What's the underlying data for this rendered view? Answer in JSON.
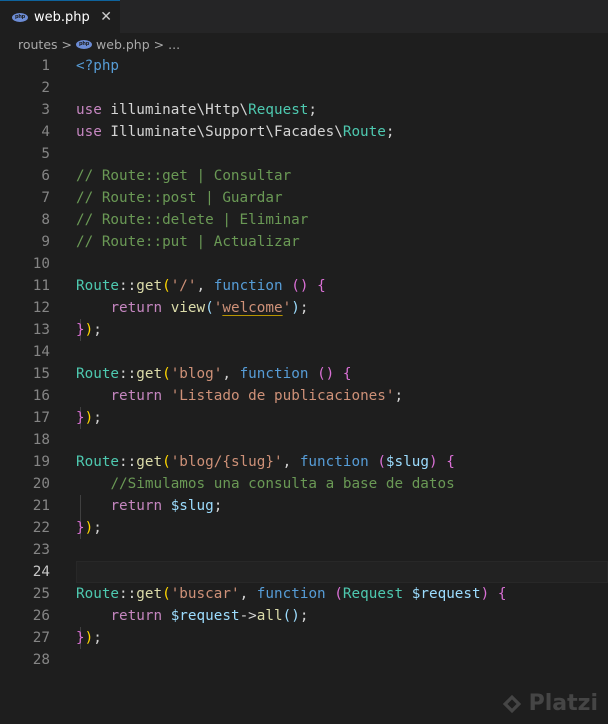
{
  "tab": {
    "title": "web.php",
    "close": "✕",
    "icon": "php-icon"
  },
  "breadcrumb": {
    "folder": "routes",
    "sep1": ">",
    "file": "web.php",
    "sep2": ">",
    "more": "..."
  },
  "editor": {
    "current_line": 24,
    "lines": [
      {
        "n": "1",
        "tokens": [
          {
            "c": "kw",
            "t": "<?php"
          }
        ]
      },
      {
        "n": "2",
        "tokens": []
      },
      {
        "n": "3",
        "tokens": [
          {
            "c": "ctl",
            "t": "use"
          },
          {
            "c": "pl",
            "t": " illuminate\\Http\\"
          },
          {
            "c": "cls",
            "t": "Request"
          },
          {
            "c": "pl",
            "t": ";"
          }
        ]
      },
      {
        "n": "4",
        "tokens": [
          {
            "c": "ctl",
            "t": "use"
          },
          {
            "c": "pl",
            "t": " Illuminate\\Support\\Facades\\"
          },
          {
            "c": "cls",
            "t": "Route"
          },
          {
            "c": "pl",
            "t": ";"
          }
        ]
      },
      {
        "n": "5",
        "tokens": []
      },
      {
        "n": "6",
        "tokens": [
          {
            "c": "cmt",
            "t": "// Route::get | Consultar"
          }
        ]
      },
      {
        "n": "7",
        "tokens": [
          {
            "c": "cmt",
            "t": "// Route::post | Guardar"
          }
        ]
      },
      {
        "n": "8",
        "tokens": [
          {
            "c": "cmt",
            "t": "// Route::delete | Eliminar"
          }
        ]
      },
      {
        "n": "9",
        "tokens": [
          {
            "c": "cmt",
            "t": "// Route::put | Actualizar"
          }
        ]
      },
      {
        "n": "10",
        "tokens": []
      },
      {
        "n": "11",
        "tokens": [
          {
            "c": "cls",
            "t": "Route"
          },
          {
            "c": "pl",
            "t": "::"
          },
          {
            "c": "fn",
            "t": "get"
          },
          {
            "c": "br1",
            "t": "("
          },
          {
            "c": "str",
            "t": "'/'"
          },
          {
            "c": "pl",
            "t": ", "
          },
          {
            "c": "kw",
            "t": "function"
          },
          {
            "c": "pl",
            "t": " "
          },
          {
            "c": "br2",
            "t": "()"
          },
          {
            "c": "pl",
            "t": " "
          },
          {
            "c": "br2",
            "t": "{"
          }
        ]
      },
      {
        "n": "12",
        "tokens": [
          {
            "c": "pl",
            "t": "    "
          },
          {
            "c": "ctl",
            "t": "return"
          },
          {
            "c": "pl",
            "t": " "
          },
          {
            "c": "fn",
            "t": "view"
          },
          {
            "c": "var",
            "t": "("
          },
          {
            "c": "str",
            "t": "'"
          },
          {
            "c": "str squiggle",
            "t": "welcome"
          },
          {
            "c": "str",
            "t": "'"
          },
          {
            "c": "var",
            "t": ")"
          },
          {
            "c": "pl",
            "t": ";"
          }
        ]
      },
      {
        "n": "13",
        "tokens": [
          {
            "c": "br2",
            "t": "}"
          },
          {
            "c": "br1",
            "t": ")"
          },
          {
            "c": "pl",
            "t": ";"
          }
        ]
      },
      {
        "n": "14",
        "tokens": []
      },
      {
        "n": "15",
        "tokens": [
          {
            "c": "cls",
            "t": "Route"
          },
          {
            "c": "pl",
            "t": "::"
          },
          {
            "c": "fn",
            "t": "get"
          },
          {
            "c": "br1",
            "t": "("
          },
          {
            "c": "str",
            "t": "'blog'"
          },
          {
            "c": "pl",
            "t": ", "
          },
          {
            "c": "kw",
            "t": "function"
          },
          {
            "c": "pl",
            "t": " "
          },
          {
            "c": "br2",
            "t": "()"
          },
          {
            "c": "pl",
            "t": " "
          },
          {
            "c": "br2",
            "t": "{"
          }
        ]
      },
      {
        "n": "16",
        "tokens": [
          {
            "c": "pl",
            "t": "    "
          },
          {
            "c": "ctl",
            "t": "return"
          },
          {
            "c": "pl",
            "t": " "
          },
          {
            "c": "str",
            "t": "'Listado de publicaciones'"
          },
          {
            "c": "pl",
            "t": ";"
          }
        ]
      },
      {
        "n": "17",
        "tokens": [
          {
            "c": "br2",
            "t": "}"
          },
          {
            "c": "br1",
            "t": ")"
          },
          {
            "c": "pl",
            "t": ";"
          }
        ]
      },
      {
        "n": "18",
        "tokens": []
      },
      {
        "n": "19",
        "tokens": [
          {
            "c": "cls",
            "t": "Route"
          },
          {
            "c": "pl",
            "t": "::"
          },
          {
            "c": "fn",
            "t": "get"
          },
          {
            "c": "br1",
            "t": "("
          },
          {
            "c": "str",
            "t": "'blog/{slug}'"
          },
          {
            "c": "pl",
            "t": ", "
          },
          {
            "c": "kw",
            "t": "function"
          },
          {
            "c": "pl",
            "t": " "
          },
          {
            "c": "br2",
            "t": "("
          },
          {
            "c": "var",
            "t": "$slug"
          },
          {
            "c": "br2",
            "t": ")"
          },
          {
            "c": "pl",
            "t": " "
          },
          {
            "c": "br2",
            "t": "{"
          }
        ]
      },
      {
        "n": "20",
        "tokens": [
          {
            "c": "pl",
            "t": "    "
          },
          {
            "c": "cmt",
            "t": "//Simulamos una consulta a base de datos"
          }
        ]
      },
      {
        "n": "21",
        "tokens": [
          {
            "c": "pl",
            "t": "    "
          },
          {
            "c": "ctl",
            "t": "return"
          },
          {
            "c": "pl",
            "t": " "
          },
          {
            "c": "var",
            "t": "$slug"
          },
          {
            "c": "pl",
            "t": ";"
          }
        ]
      },
      {
        "n": "22",
        "tokens": [
          {
            "c": "br2",
            "t": "}"
          },
          {
            "c": "br1",
            "t": ")"
          },
          {
            "c": "pl",
            "t": ";"
          }
        ]
      },
      {
        "n": "23",
        "tokens": []
      },
      {
        "n": "24",
        "tokens": []
      },
      {
        "n": "25",
        "tokens": [
          {
            "c": "cls",
            "t": "Route"
          },
          {
            "c": "pl",
            "t": "::"
          },
          {
            "c": "fn",
            "t": "get"
          },
          {
            "c": "br1",
            "t": "("
          },
          {
            "c": "str",
            "t": "'buscar'"
          },
          {
            "c": "pl",
            "t": ", "
          },
          {
            "c": "kw",
            "t": "function"
          },
          {
            "c": "pl",
            "t": " "
          },
          {
            "c": "br2",
            "t": "("
          },
          {
            "c": "cls",
            "t": "Request"
          },
          {
            "c": "pl",
            "t": " "
          },
          {
            "c": "var",
            "t": "$request"
          },
          {
            "c": "br2",
            "t": ")"
          },
          {
            "c": "pl",
            "t": " "
          },
          {
            "c": "br2",
            "t": "{"
          }
        ]
      },
      {
        "n": "26",
        "tokens": [
          {
            "c": "pl",
            "t": "    "
          },
          {
            "c": "ctl",
            "t": "return"
          },
          {
            "c": "pl",
            "t": " "
          },
          {
            "c": "var",
            "t": "$request"
          },
          {
            "c": "pl",
            "t": "->"
          },
          {
            "c": "fn",
            "t": "all"
          },
          {
            "c": "var",
            "t": "()"
          },
          {
            "c": "pl",
            "t": ";"
          }
        ]
      },
      {
        "n": "27",
        "tokens": [
          {
            "c": "br2",
            "t": "}"
          },
          {
            "c": "br1",
            "t": ")"
          },
          {
            "c": "pl",
            "t": ";"
          }
        ]
      },
      {
        "n": "28",
        "tokens": []
      }
    ]
  },
  "watermark": {
    "text": "Platzi",
    "icon": "platzi-logo-icon"
  }
}
